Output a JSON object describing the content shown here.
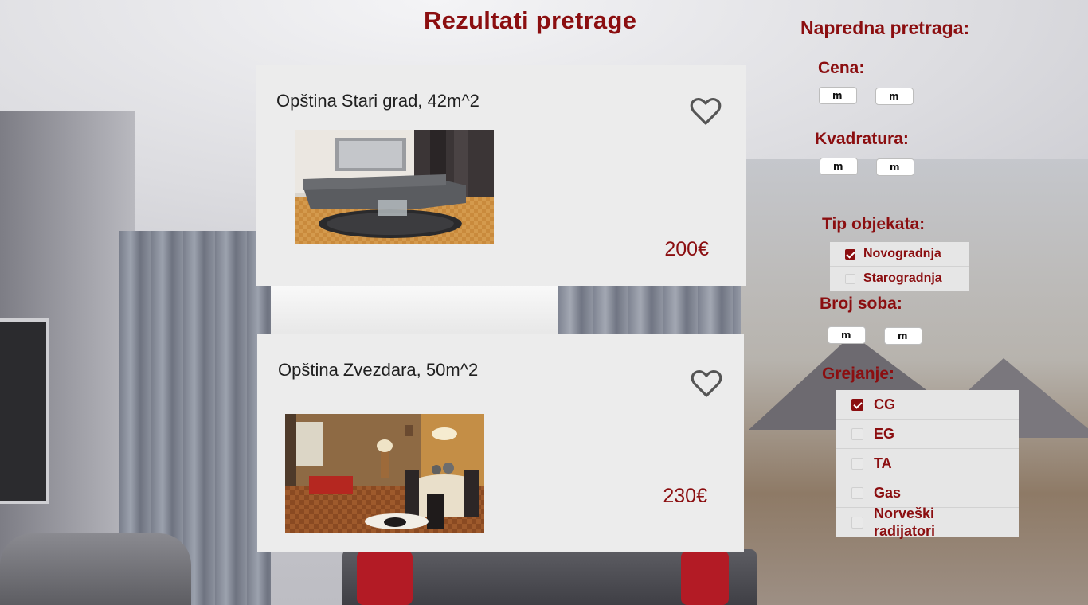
{
  "page": {
    "title": "Rezultati pretrage"
  },
  "listings": [
    {
      "title": "Opština Stari grad, 42m^2",
      "price": "200€",
      "photo": "living-room-grey-sofa"
    },
    {
      "title": "Opština Zvezdara, 50m^2",
      "price": "230€",
      "photo": "living-dining-room"
    }
  ],
  "filters": {
    "title": "Napredna pretraga:",
    "cena": {
      "label": "Cena:",
      "min": "m",
      "max": "m"
    },
    "kvadratura": {
      "label": "Kvadratura:",
      "min": "m",
      "max": "m"
    },
    "tip_objekata": {
      "label": "Tip objekata:",
      "options": [
        {
          "label": "Novogradnja",
          "checked": true
        },
        {
          "label": "Starogradnja",
          "checked": false
        }
      ]
    },
    "broj_soba": {
      "label": "Broj soba:",
      "min": "m",
      "max": "m"
    },
    "grejanje": {
      "label": "Grejanje:",
      "options": [
        {
          "label": "CG",
          "checked": true
        },
        {
          "label": "EG",
          "checked": false
        },
        {
          "label": "TA",
          "checked": false
        },
        {
          "label": "Gas",
          "checked": false
        },
        {
          "label": "Norveški radijatori",
          "checked": false
        }
      ]
    }
  },
  "colors": {
    "accent": "#8b0e10",
    "card": "#ececec"
  }
}
